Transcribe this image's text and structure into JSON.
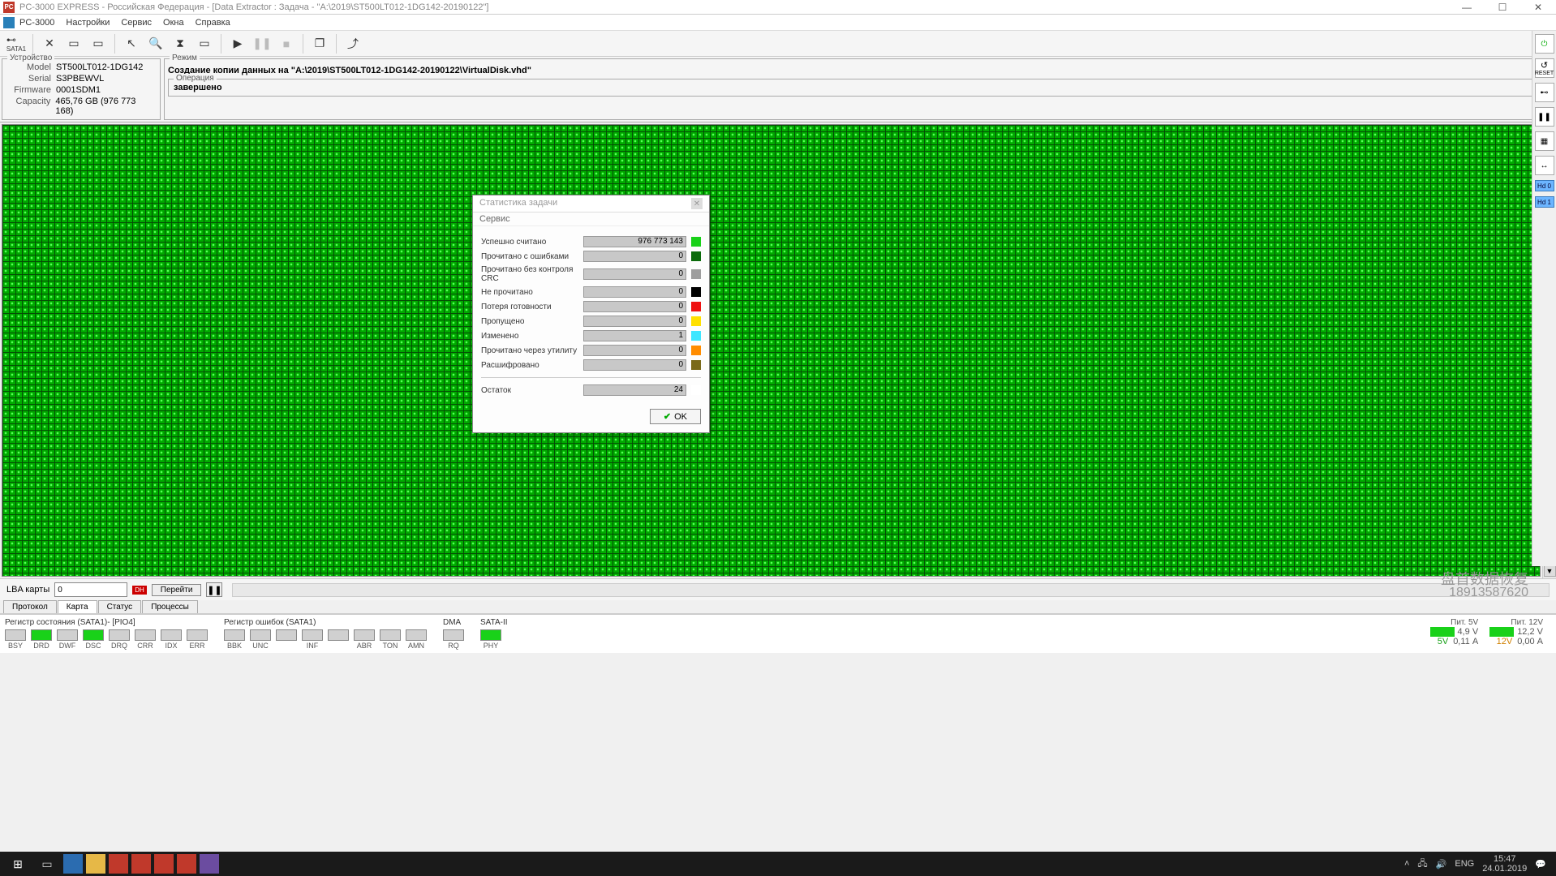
{
  "titlebar": {
    "text": "PC-3000 EXPRESS - Российская Федерация - [Data Extractor : Задача - \"A:\\2019\\ST500LT012-1DG142-20190122\"]"
  },
  "menubar": {
    "app": "PC-3000",
    "items": [
      "Настройки",
      "Сервис",
      "Окна",
      "Справка"
    ]
  },
  "device": {
    "group_title": "Устройство",
    "model_label": "Model",
    "model": "ST500LT012-1DG142",
    "serial_label": "Serial",
    "serial": "S3PBEWVL",
    "firmware_label": "Firmware",
    "firmware": "0001SDM1",
    "capacity_label": "Capacity",
    "capacity": "465,76 GB (976 773 168)"
  },
  "mode": {
    "group_title": "Режим",
    "text": "Создание копии данных на \"A:\\2019\\ST500LT012-1DG142-20190122\\VirtualDisk.vhd\"",
    "op_title": "Операция",
    "op_text": "завершено"
  },
  "lba": {
    "label": "LBA карты",
    "value": "0",
    "go": "Перейти"
  },
  "tabs": [
    "Протокол",
    "Карта",
    "Статус",
    "Процессы"
  ],
  "registers": {
    "status_title": "Регистр состояния (SATA1)- [PIO4]",
    "status": [
      {
        "lbl": "BSY",
        "color": "#d0d0d0"
      },
      {
        "lbl": "DRD",
        "color": "#19d119"
      },
      {
        "lbl": "DWF",
        "color": "#d0d0d0"
      },
      {
        "lbl": "DSC",
        "color": "#19d119"
      },
      {
        "lbl": "DRQ",
        "color": "#d0d0d0"
      },
      {
        "lbl": "CRR",
        "color": "#d0d0d0"
      },
      {
        "lbl": "IDX",
        "color": "#d0d0d0"
      },
      {
        "lbl": "ERR",
        "color": "#d0d0d0"
      }
    ],
    "error_title": "Регистр ошибок  (SATA1)",
    "error": [
      {
        "lbl": "BBK",
        "color": "#d0d0d0"
      },
      {
        "lbl": "UNC",
        "color": "#d0d0d0"
      },
      {
        "lbl": "",
        "color": "#d0d0d0"
      },
      {
        "lbl": "INF",
        "color": "#d0d0d0"
      },
      {
        "lbl": "",
        "color": "#d0d0d0"
      },
      {
        "lbl": "ABR",
        "color": "#d0d0d0"
      },
      {
        "lbl": "TON",
        "color": "#d0d0d0"
      },
      {
        "lbl": "AMN",
        "color": "#d0d0d0"
      }
    ],
    "dma_title": "DMA",
    "dma": [
      {
        "lbl": "RQ",
        "color": "#d0d0d0"
      }
    ],
    "sataii_title": "SATA-II",
    "sataii": [
      {
        "lbl": "PHY",
        "color": "#19d119"
      }
    ]
  },
  "power": {
    "p5_title": "Пит. 5V",
    "p5_v": "4,9 V",
    "p5_a": "0,11 А",
    "p5_lbl": "5V",
    "p12_title": "Пит. 12V",
    "p12_v": "12,2 V",
    "p12_a": "0,00 А",
    "p12_lbl": "12V"
  },
  "side_hd": {
    "hd0": "Hd 0",
    "hd1": "Hd 1"
  },
  "watermark": {
    "line1": "盘首数据恢复",
    "line2": "18913587620"
  },
  "dialog": {
    "title": "Статистика задачи",
    "menu": "Сервис",
    "rows": [
      {
        "label": "Успешно считано",
        "value": "976 773 143",
        "color": "#19d119"
      },
      {
        "label": "Прочитано с ошибками",
        "value": "0",
        "color": "#0b6b0b"
      },
      {
        "label": "Прочитано без контроля CRC",
        "value": "0",
        "color": "#9e9e9e"
      },
      {
        "label": "Не прочитано",
        "value": "0",
        "color": "#000000"
      },
      {
        "label": "Потеря готовности",
        "value": "0",
        "color": "#e11"
      },
      {
        "label": "Пропущено",
        "value": "0",
        "color": "#ffe000"
      },
      {
        "label": "Изменено",
        "value": "1",
        "color": "#3fe6ff"
      },
      {
        "label": "Прочитано через утилиту",
        "value": "0",
        "color": "#ff8c00"
      },
      {
        "label": "Расшифровано",
        "value": "0",
        "color": "#7a6a1a"
      }
    ],
    "remain_label": "Остаток",
    "remain_value": "24",
    "ok": "OK"
  },
  "taskbar": {
    "lang": "ENG",
    "time": "15:47",
    "date": "24.01.2019"
  }
}
